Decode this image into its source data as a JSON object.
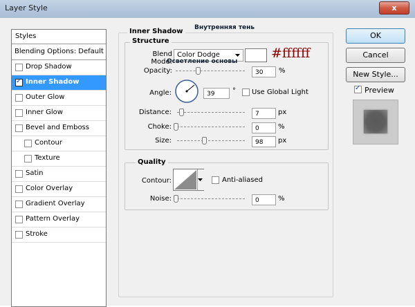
{
  "window": {
    "title": "Layer Style",
    "close_glyph": "x"
  },
  "sidebar": {
    "header": "Styles",
    "blending": "Blending Options: Default",
    "items": [
      {
        "label": "Drop Shadow",
        "checked": false
      },
      {
        "label": "Inner Shadow",
        "checked": true,
        "selected": true
      },
      {
        "label": "Outer Glow",
        "checked": false
      },
      {
        "label": "Inner Glow",
        "checked": false
      },
      {
        "label": "Bevel and Emboss",
        "checked": false
      },
      {
        "label": "Contour",
        "checked": false
      },
      {
        "label": "Texture",
        "checked": false
      },
      {
        "label": "Satin",
        "checked": false
      },
      {
        "label": "Color Overlay",
        "checked": false
      },
      {
        "label": "Gradient Overlay",
        "checked": false
      },
      {
        "label": "Pattern Overlay",
        "checked": false
      },
      {
        "label": "Stroke",
        "checked": false
      }
    ]
  },
  "inner_shadow": {
    "title": "Inner Shadow",
    "russian_title": "Внутренняя тень",
    "structure": {
      "title": "Structure",
      "blend_mode_label": "Blend Mode:",
      "blend_mode_value": "Color Dodge",
      "blend_mode_russian": "Осветление основы",
      "color_hex": "#ffffff",
      "color_label": "#ffffff",
      "opacity_label": "Opacity:",
      "opacity_value": "30",
      "opacity_unit": "%",
      "opacity": 30,
      "angle_label": "Angle:",
      "angle_value": "39",
      "angle_unit": "°",
      "angle": 39,
      "global_light_label": "Use Global Light",
      "global_light": false,
      "distance_label": "Distance:",
      "distance_value": "7",
      "distance_unit": "px",
      "distance": 7,
      "choke_label": "Choke:",
      "choke_value": "0",
      "choke_unit": "%",
      "choke": 0,
      "size_label": "Size:",
      "size_value": "98",
      "size_unit": "px",
      "size": 98
    },
    "quality": {
      "title": "Quality",
      "contour_label": "Contour:",
      "anti_aliased_label": "Anti-aliased",
      "anti_aliased": false,
      "noise_label": "Noise:",
      "noise_value": "0",
      "noise_unit": "%",
      "noise": 0
    }
  },
  "buttons": {
    "ok": "OK",
    "cancel": "Cancel",
    "new_style": "New Style..."
  },
  "preview": {
    "label": "Preview",
    "checked": true
  },
  "colors": {
    "title_red": "#8b0000",
    "selection": "#3399ff",
    "swatch": "#ffffff"
  },
  "icons": [
    "close-icon",
    "dropdown-arrow-icon",
    "angle-dial-icon",
    "contour-curve-icon",
    "checkbox-icon"
  ]
}
